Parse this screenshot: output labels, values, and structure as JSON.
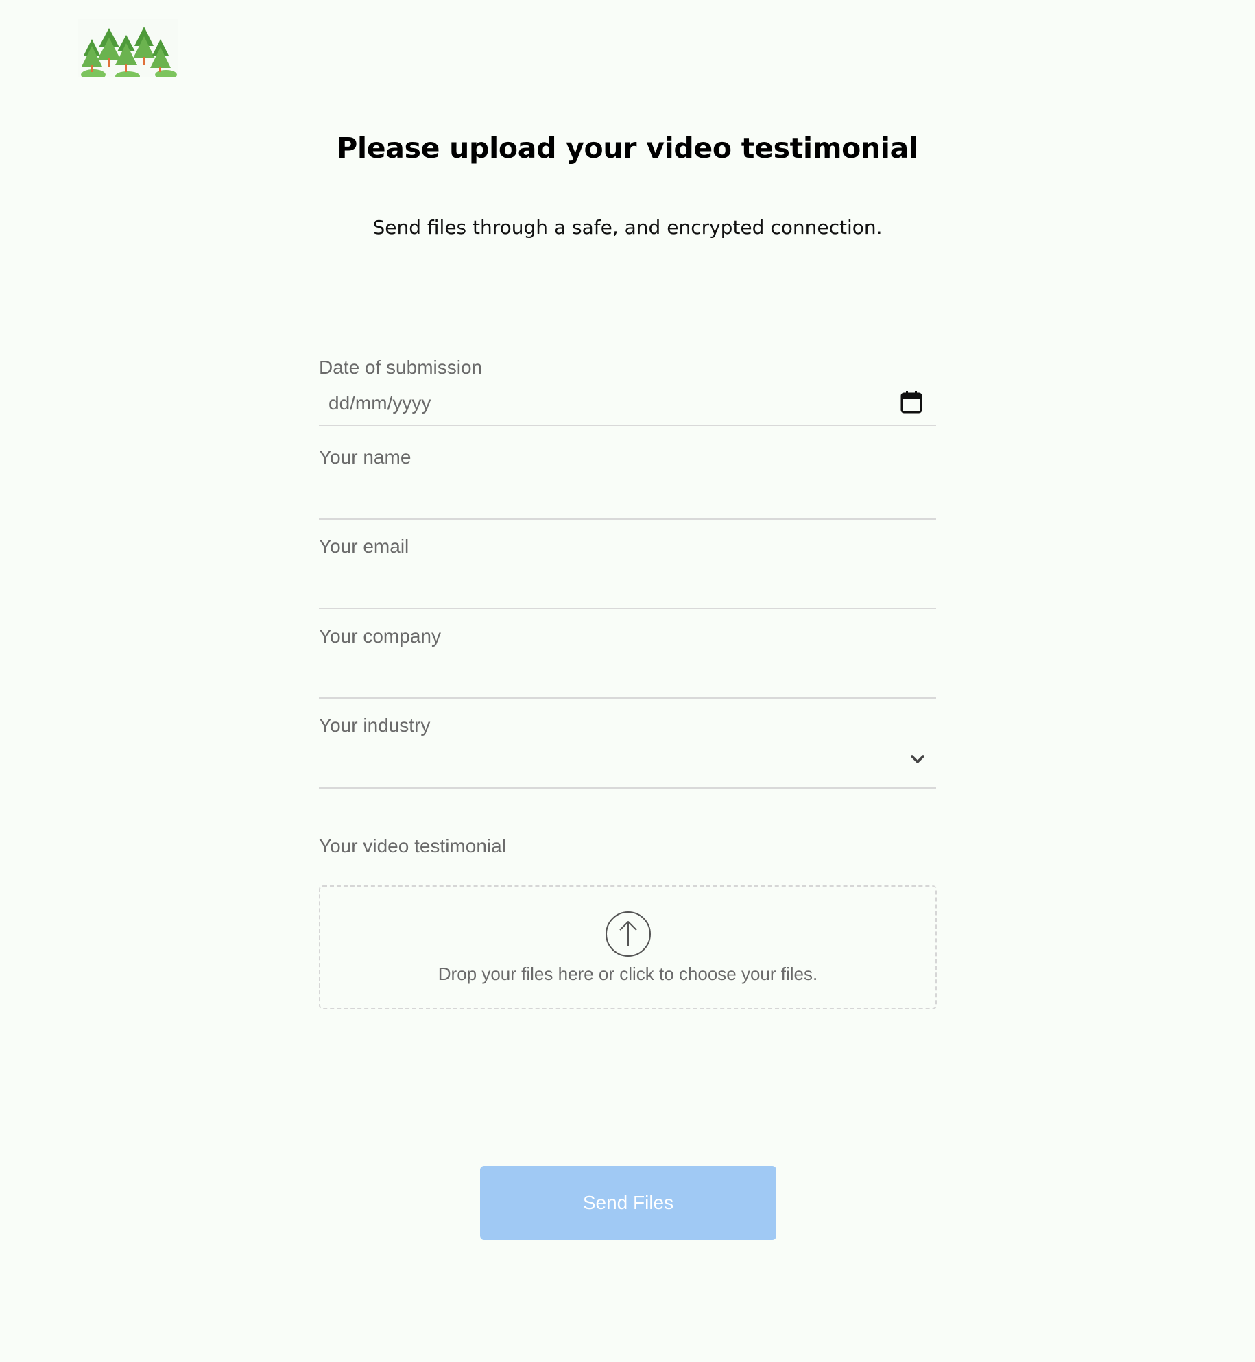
{
  "logo": {
    "icon": "pine-trees-logo",
    "colors": {
      "tree_dark": "#4e9a3a",
      "tree_light": "#7cc45d",
      "trunk": "#e0703a"
    }
  },
  "header": {
    "title": "Please upload your video testimonial",
    "subtitle": "Send files through a safe, and encrypted connection."
  },
  "form": {
    "date": {
      "label": "Date of submission",
      "value": "dd/mm/yyyy",
      "icon": "calendar-icon"
    },
    "name": {
      "label": "Your name",
      "value": ""
    },
    "email": {
      "label": "Your email",
      "value": ""
    },
    "company": {
      "label": "Your company",
      "value": ""
    },
    "industry": {
      "label": "Your industry",
      "selected": "",
      "icon": "chevron-down-icon"
    },
    "video": {
      "label": "Your video testimonial",
      "dropzone_text": "Drop your files here or click to choose your files.",
      "icon": "upload-arrow-icon"
    }
  },
  "submit": {
    "label": "Send Files",
    "color": "#a0c9f4"
  },
  "colors": {
    "background": "#f9fdf8",
    "label_text": "#6a6a6a",
    "divider": "#d9d9d9"
  }
}
